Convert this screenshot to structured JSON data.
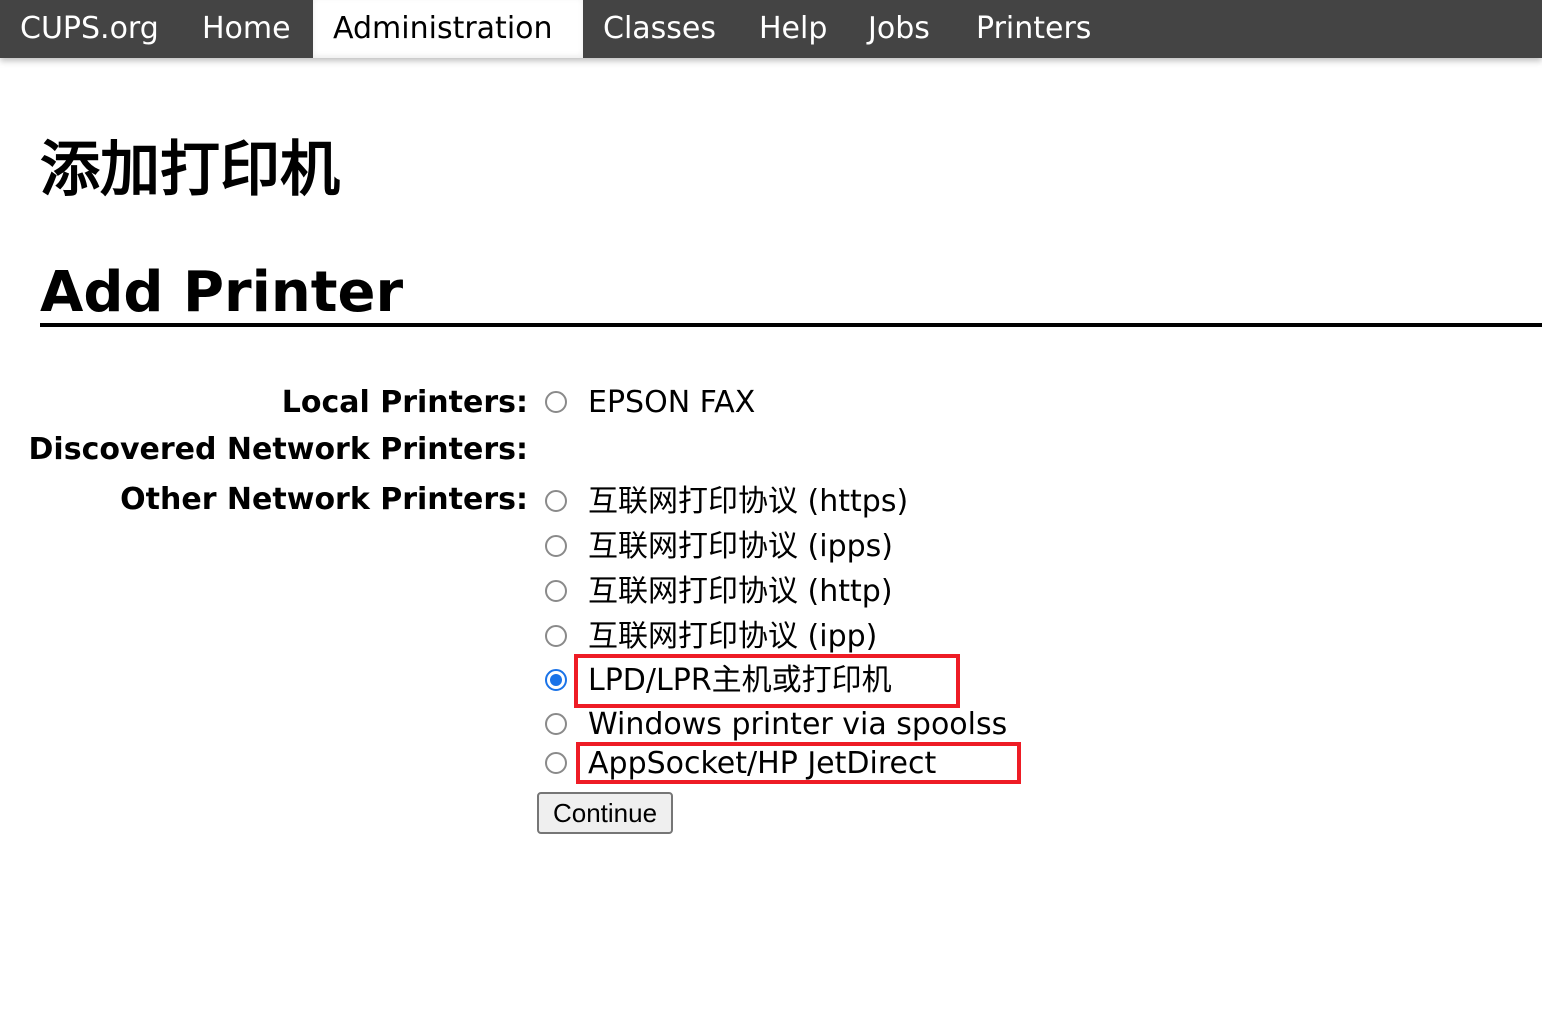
{
  "nav": {
    "items": [
      {
        "label": "CUPS.org",
        "active": false
      },
      {
        "label": "Home",
        "active": false
      },
      {
        "label": "Administration",
        "active": true
      },
      {
        "label": "Classes",
        "active": false
      },
      {
        "label": "Help",
        "active": false
      },
      {
        "label": "Jobs",
        "active": false
      },
      {
        "label": "Printers",
        "active": false
      }
    ]
  },
  "page": {
    "title_cn": "添加打印机",
    "heading": "Add Printer"
  },
  "form": {
    "labels": {
      "local": "Local Printers:",
      "discovered": "Discovered Network Printers:",
      "other": "Other Network Printers:"
    },
    "local_printers": [
      {
        "label": "EPSON FAX",
        "checked": false
      }
    ],
    "discovered_printers": [],
    "other_printers": [
      {
        "label": "互联网打印协议 (https)",
        "checked": false,
        "highlighted": false
      },
      {
        "label": "互联网打印协议 (ipps)",
        "checked": false,
        "highlighted": false
      },
      {
        "label": "互联网打印协议 (http)",
        "checked": false,
        "highlighted": false
      },
      {
        "label": "互联网打印协议 (ipp)",
        "checked": false,
        "highlighted": false
      },
      {
        "label": "LPD/LPR主机或打印机",
        "checked": true,
        "highlighted": true
      },
      {
        "label": "Windows printer via spoolss",
        "checked": false,
        "highlighted": false
      },
      {
        "label": "AppSocket/HP JetDirect",
        "checked": false,
        "highlighted": true
      }
    ],
    "continue_label": "Continue"
  },
  "colors": {
    "navbar_bg": "#444444",
    "radio_checked": "#1a73e8",
    "highlight_box": "#ee1c25"
  }
}
